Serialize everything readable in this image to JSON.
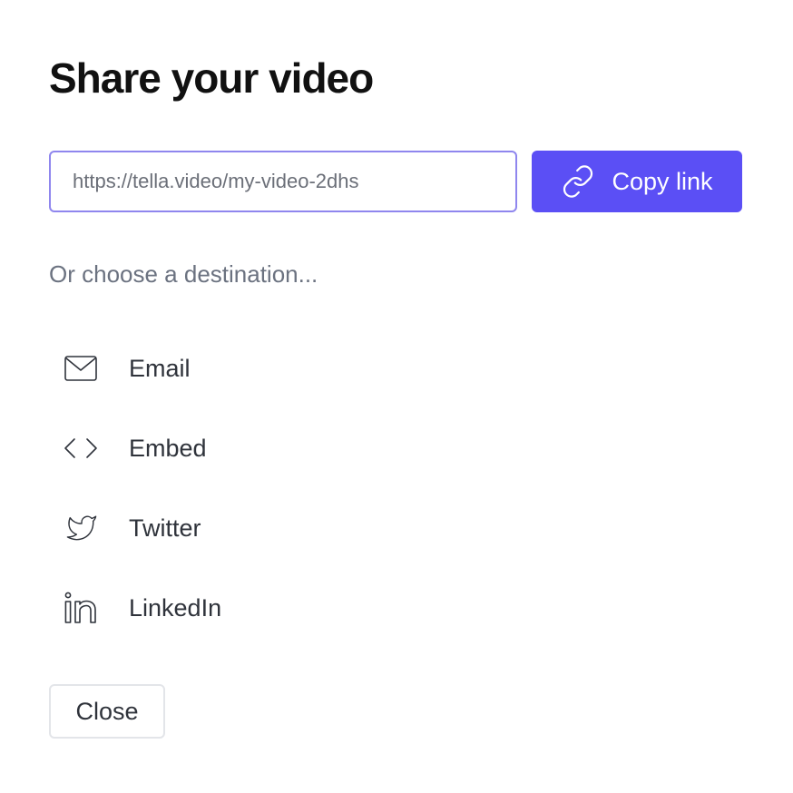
{
  "dialog": {
    "title": "Share your video"
  },
  "share": {
    "url_value": "https://tella.video/my-video-2dhs",
    "copy_label": "Copy link"
  },
  "destinations": {
    "prompt": "Or choose a destination...",
    "items": [
      {
        "label": "Email",
        "icon": "mail-icon"
      },
      {
        "label": "Embed",
        "icon": "code-icon"
      },
      {
        "label": "Twitter",
        "icon": "twitter-icon"
      },
      {
        "label": "LinkedIn",
        "icon": "linkedin-icon"
      }
    ]
  },
  "footer": {
    "close_label": "Close"
  },
  "colors": {
    "accent": "#5b4ff5",
    "input_border": "#8f86ee",
    "muted_text": "#6b7280"
  }
}
